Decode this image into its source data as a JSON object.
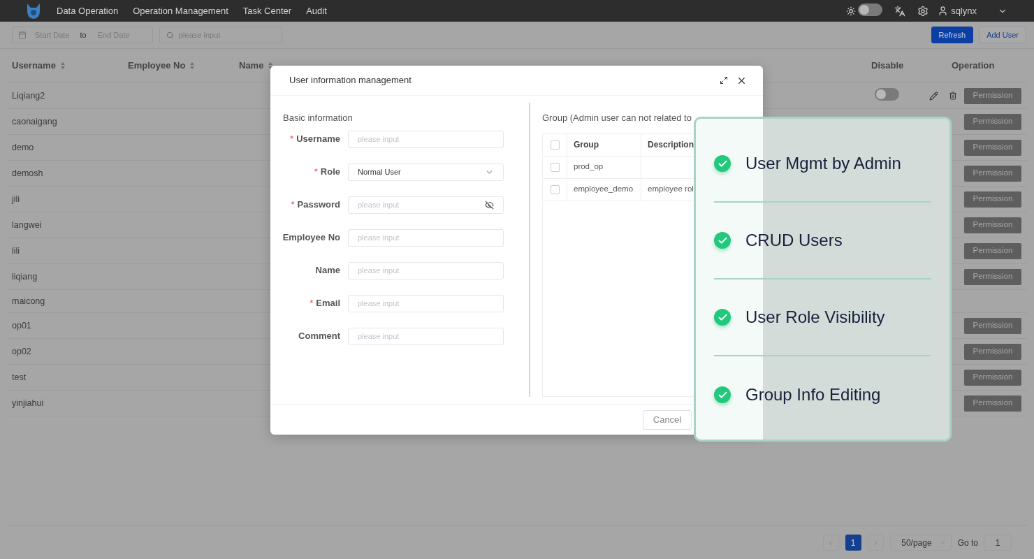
{
  "nav": {
    "items": [
      {
        "label": "Data Operation"
      },
      {
        "label": "Operation Management"
      },
      {
        "label": "Task Center"
      },
      {
        "label": "Audit"
      }
    ],
    "theme_toggle": {
      "on": false
    },
    "user": "sqlynx"
  },
  "toolbar": {
    "start_placeholder": "Start Date",
    "separator": "to",
    "end_placeholder": "End Date",
    "search_placeholder": "please input",
    "buttons": [
      {
        "label": "Refresh",
        "kind": "primary"
      },
      {
        "label": "Add User",
        "kind": "outline"
      }
    ]
  },
  "table": {
    "columns": [
      {
        "label": "Username",
        "sortable": true
      },
      {
        "label": "Employee No",
        "sortable": true
      },
      {
        "label": "Name",
        "sortable": true
      },
      {
        "label": "Disable",
        "sortable": false
      },
      {
        "label": "Operation",
        "sortable": false
      }
    ],
    "rows": [
      {
        "username": "Liqiang2",
        "disabled": false,
        "permission": "Permission"
      },
      {
        "username": "caonaigang",
        "permission": "Permission"
      },
      {
        "username": "demo",
        "permission": "Permission"
      },
      {
        "username": "demosh",
        "permission": "Permission"
      },
      {
        "username": "jili",
        "permission": "Permission"
      },
      {
        "username": "langwei",
        "permission": "Permission"
      },
      {
        "username": "lili",
        "permission": "Permission"
      },
      {
        "username": "liqiang",
        "permission": "Permission"
      },
      {
        "username": "maicong"
      },
      {
        "username": "op01",
        "permission": "Permission"
      },
      {
        "username": "op02",
        "permission": "Permission"
      },
      {
        "username": "test",
        "permission": "Permission"
      },
      {
        "username": "yinjiahui",
        "permission": "Permission"
      }
    ]
  },
  "modal": {
    "title": "User information management",
    "section": "Basic information",
    "fields": [
      {
        "label": "Username",
        "required_mark": "*",
        "kind": "input",
        "placeholder": "please input"
      },
      {
        "label": "Role",
        "required_mark": "*",
        "kind": "select",
        "value": "Normal User"
      },
      {
        "label": "Password",
        "required_mark": "*",
        "kind": "password",
        "placeholder": "please input"
      },
      {
        "label": "Employee No",
        "kind": "input",
        "placeholder": "please input"
      },
      {
        "label": "Name",
        "kind": "input",
        "placeholder": "please input"
      },
      {
        "label": "Email",
        "required_mark": "*",
        "kind": "input",
        "placeholder": "please input"
      },
      {
        "label": "Comment",
        "kind": "input",
        "placeholder": "please input"
      }
    ],
    "group_title": "Group (Admin user can not related to",
    "select_all": {
      "checked": false
    },
    "group_columns": [
      "Group",
      "Description"
    ],
    "groups": [
      {
        "group": "prod_op",
        "checked": false
      },
      {
        "group": "employee_demo",
        "description": "employee rol",
        "checked": false
      }
    ],
    "cancel": "Cancel"
  },
  "features": [
    {
      "label": "User Mgmt by Admin",
      "checked": true
    },
    {
      "label": "CRUD Users",
      "checked": true
    },
    {
      "label": "User Role Visibility",
      "checked": true
    },
    {
      "label": "Group Info Editing",
      "checked": true
    }
  ],
  "pagination": {
    "pages": [
      {
        "label": "1",
        "selected": true
      }
    ],
    "page_size": "50/page",
    "goto_label": "Go to",
    "goto_value": "1"
  }
}
